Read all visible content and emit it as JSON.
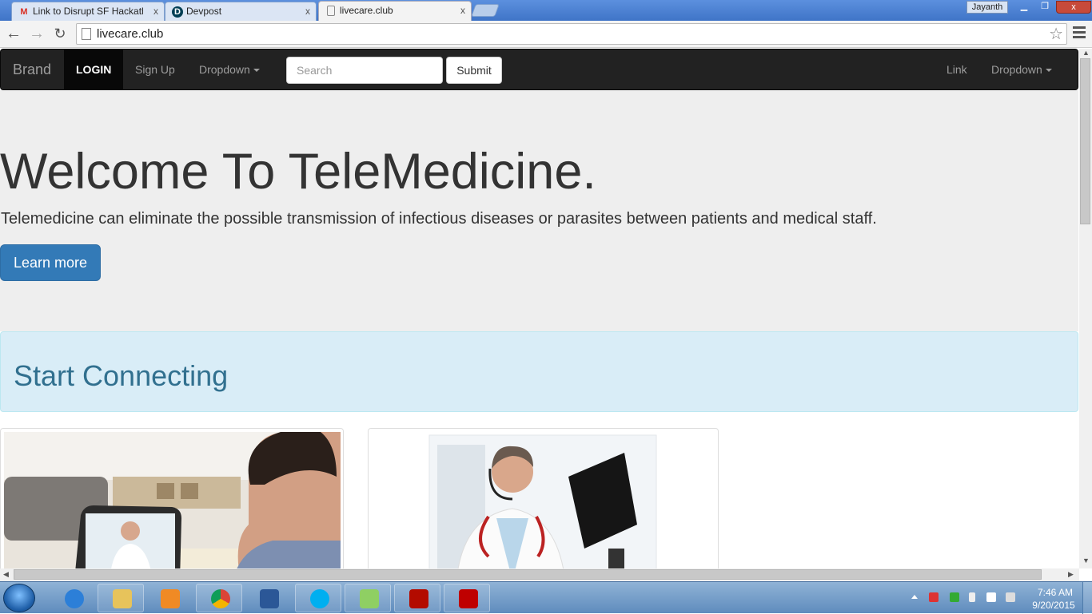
{
  "browser": {
    "tabs": [
      {
        "title": "Link to Disrupt SF Hackath",
        "icon": "gmail-icon"
      },
      {
        "title": "Devpost",
        "icon": "devpost-icon"
      },
      {
        "title": "livecare.club",
        "icon": "page-icon"
      }
    ],
    "active_tab": 2,
    "user": "Jayanth",
    "url": "livecare.club",
    "window_controls": [
      "minimize-icon",
      "restore-icon",
      "close-icon"
    ],
    "close_glyph": "x"
  },
  "navbar": {
    "brand": "Brand",
    "items": [
      "LOGIN",
      "Sign Up",
      "Dropdown"
    ],
    "search_placeholder": "Search",
    "submit": "Submit",
    "right_items": [
      "Link",
      "Dropdown"
    ]
  },
  "hero": {
    "title": "Welcome To TeleMedicine.",
    "lead": "Telemedicine can eliminate the possible transmission of infectious diseases or parasites between patients and medical staff.",
    "button": "Learn more"
  },
  "alert": {
    "heading": "Start Connecting"
  },
  "taskbar": {
    "apps": [
      "internet-explorer-icon",
      "file-explorer-icon",
      "media-player-icon",
      "chrome-icon",
      "word-icon",
      "skype-icon",
      "notepad-icon",
      "acrobat-icon",
      "filezilla-icon"
    ],
    "time": "7:46 AM",
    "date": "9/20/2015"
  },
  "colors": {
    "navbar_bg": "#222222",
    "jumbotron_bg": "#eeeeee",
    "primary": "#337ab7",
    "alert_bg": "#d9edf7",
    "alert_text": "#31708f"
  }
}
